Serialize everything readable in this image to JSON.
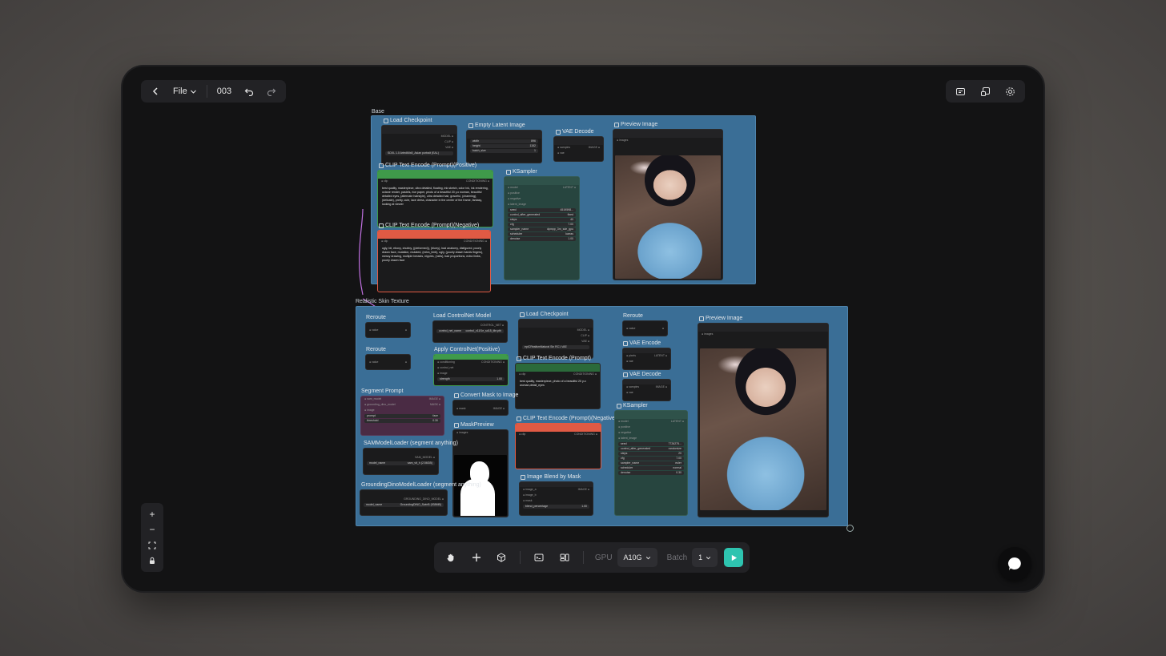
{
  "topbar": {
    "file_label": "File",
    "workflow_id": "003"
  },
  "groups": {
    "base": {
      "title": "Base",
      "nodes": {
        "load_checkpoint": "Load Checkpoint",
        "empty_latent": "Empty Latent Image",
        "vae_decode": "VAE Decode",
        "preview_image": "Preview Image",
        "clip_positive": "CLIP Text Encode (Prompt)(Positive)",
        "clip_negative": "CLIP Text Encode (Prompt)(Negative)",
        "ksampler": "KSampler"
      },
      "checkpoint_name": "SDXL 1.0 ArtedMix8_Asian portrait (EAL)",
      "positive_text": "best quality, masterpiece, ultra detailed, floating, ink sketch, color ink, ink rendering, octane render, pastels, rice paper, photo of a beautiful 20 y.o woman, beautiful detailed eyes, (alternate hairstyle), ultra detailed hair, graceful, (charming), (delicate), pretty, cute, lace dress, character in the center of the frame, fantasy, looking at viewer",
      "negative_text": "ugly, bit, ebony, chubby, ((deformed)), (blurry), bad anatomy, disfigured, poorly drawn face, mutation, mutated, (extra_limb), ugly, (poorly drawn hands fingers), messy drawing, multiple breasts, nipples, (nsfw), bad proportions, extra limbs, poorly drawn face",
      "ksampler_fields": [
        {
          "k": "seed",
          "v": "4519598..."
        },
        {
          "k": "control_after_generated",
          "v": "fixed"
        },
        {
          "k": "steps",
          "v": "40"
        },
        {
          "k": "cfg",
          "v": "7.00"
        },
        {
          "k": "sampler_name",
          "v": "dpmpp_3m_sde_gpu"
        },
        {
          "k": "scheduler",
          "v": "karras"
        },
        {
          "k": "denoise",
          "v": "1.00"
        }
      ],
      "latent_fields": [
        {
          "k": "width",
          "v": "896"
        },
        {
          "k": "height",
          "v": "1152"
        },
        {
          "k": "batch_size",
          "v": "1"
        }
      ]
    },
    "skin": {
      "title": "Realistic Skin Texture",
      "nodes": {
        "reroute1": "Reroute",
        "reroute2": "Reroute",
        "load_controlnet": "Load ControlNet Model",
        "apply_controlnet": "Apply ControlNet(Positive)",
        "load_checkpoint": "Load Checkpoint",
        "clip_text": "CLIP Text Encode (Prompt)",
        "reroute3": "Reroute",
        "vae_encode": "VAE Encode",
        "vae_decode": "VAE Decode",
        "preview_image": "Preview Image",
        "segment_prompt": "Segment Prompt",
        "convert_mask": "Convert Mask to Image",
        "mask_preview": "MaskPreview",
        "sam_loader": "SAMModelLoader (segment anything)",
        "grounding_loader": "GroundingDinoModelLoader (segment anything)",
        "clip_negative": "CLIP Text Encode (Prompt)(Negative)",
        "ksampler": "KSampler",
        "image_blend": "Image Blend by Mask"
      },
      "clip_text": "best quality, masterpiece, photo of a beautiful 20 y.o woman,detail_eyes",
      "controlnet_name": "control_v11f1e_sd15_tile.pth",
      "checkpoint_name": "epiCRealismNatural Sin RC1 VAE",
      "sam_model": "sam_vit_h (2.56GB)",
      "grounding_model": "GroundingDINO_SwinB (938MB)",
      "segment_fields": [
        {
          "k": "prompt",
          "v": "face"
        },
        {
          "k": "threshold",
          "v": "0.30"
        }
      ],
      "ksampler_fields": [
        {
          "k": "seed",
          "v": "7726275..."
        },
        {
          "k": "control_after_generated",
          "v": "randomize"
        },
        {
          "k": "steps",
          "v": "20"
        },
        {
          "k": "cfg",
          "v": "7.00"
        },
        {
          "k": "sampler_name",
          "v": "euler"
        },
        {
          "k": "scheduler",
          "v": "normal"
        },
        {
          "k": "denoise",
          "v": "0.30"
        }
      ],
      "blend_percentage": "1.00",
      "strength": "1.00"
    }
  },
  "bottombar": {
    "gpu_label": "GPU",
    "gpu_value": "A10G",
    "batch_label": "Batch",
    "batch_value": "1"
  },
  "colors": {
    "accent": "#2ec4b0",
    "group_bg": "#3a6e96",
    "positive": "#3f9a4a",
    "negative": "#e05a44"
  }
}
